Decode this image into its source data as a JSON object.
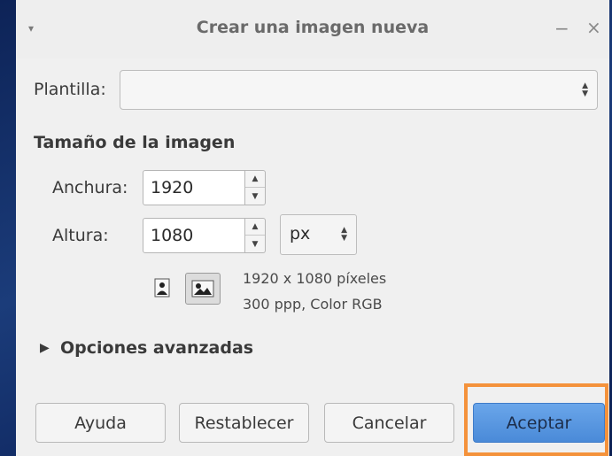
{
  "dialog": {
    "title": "Crear una imagen nueva",
    "menu_glyph": "▾",
    "minimize_glyph": "−",
    "close_glyph": "×"
  },
  "template": {
    "label": "Plantilla:",
    "value": ""
  },
  "image_size": {
    "heading": "Tamaño de la imagen",
    "width_label": "Anchura:",
    "width_value": "1920",
    "height_label": "Altura:",
    "height_value": "1080",
    "unit": "px",
    "info_dimensions": "1920 x 1080 píxeles",
    "info_resolution": "300 ppp, Color RGB",
    "orientation_selected": "landscape"
  },
  "advanced": {
    "label": "Opciones avanzadas",
    "arrow": "▶"
  },
  "buttons": {
    "help": "Ayuda",
    "reset": "Restablecer",
    "cancel": "Cancelar",
    "ok": "Aceptar"
  },
  "colors": {
    "highlight": "#f4923b",
    "primary_button": "#4a8ad8"
  }
}
